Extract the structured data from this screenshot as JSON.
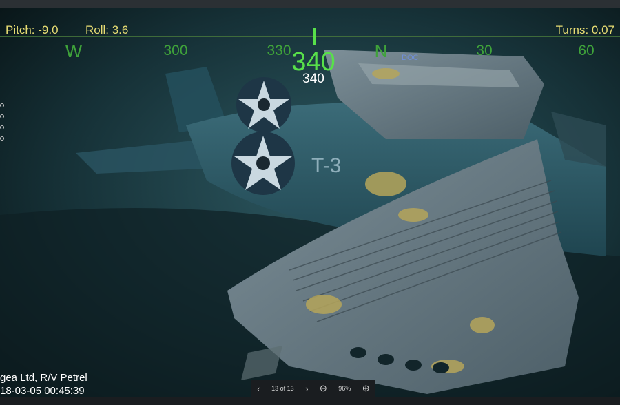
{
  "hud": {
    "pitch": "Pitch: -9.0",
    "roll": "Roll: 3.6",
    "turns": "Turns: 0.07",
    "heading_big": "340",
    "heading_small": "340",
    "compass": [
      "W",
      "300",
      "330",
      "N",
      "30",
      "60"
    ],
    "heading_marker_label": "DOC"
  },
  "caption": {
    "line1": "gea Ltd, R/V Petrel",
    "line2": "18-03-05 00:45:39"
  },
  "pager": {
    "counter": "13 of 13",
    "zoom": "96%"
  },
  "aircraft_marking": "T-3",
  "colors": {
    "hud_yellow": "#e7dc73",
    "compass_green": "#3fa33a",
    "heading_green": "#58e04a"
  },
  "icons": {
    "prev": "chevron-left-icon",
    "next": "chevron-right-icon",
    "zoom_out": "zoom-out-icon",
    "zoom_in": "zoom-in-icon"
  }
}
